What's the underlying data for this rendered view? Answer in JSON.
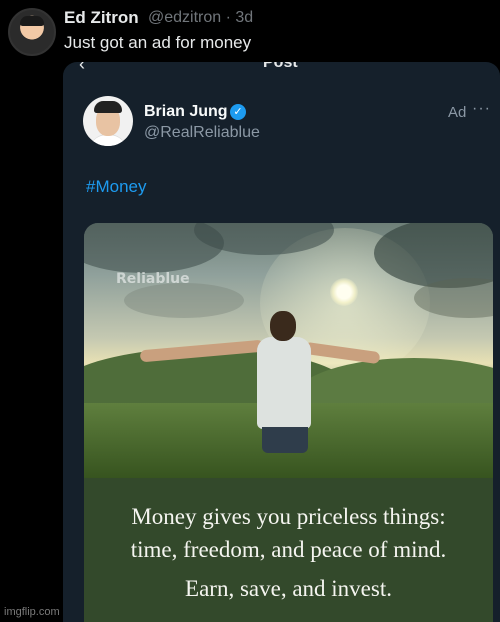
{
  "outer_post": {
    "author_name": "Ed Zitron",
    "author_handle": "@edzitron · 3d",
    "text": "Just got an ad for money"
  },
  "screenshot": {
    "header_title": "Post",
    "back_icon": "back-arrow-icon",
    "ad_post": {
      "author_name": "Brian Jung",
      "verified_icon": "verified-badge-icon",
      "author_handle": "@RealReliablue",
      "ad_label": "Ad",
      "more_icon": "more-options-icon",
      "hashtag": "#Money",
      "image": {
        "watermark": "Reliablue",
        "caption_line1": "Money gives you priceless things:",
        "caption_line2": "time, freedom, and peace of mind.",
        "caption_line3": "Earn, save, and invest."
      }
    }
  },
  "watermark_site": "imgflip.com",
  "colors": {
    "background": "#000000",
    "card_background": "#15202b",
    "link_blue": "#1d9bf0",
    "caption_box": "#33492b"
  }
}
